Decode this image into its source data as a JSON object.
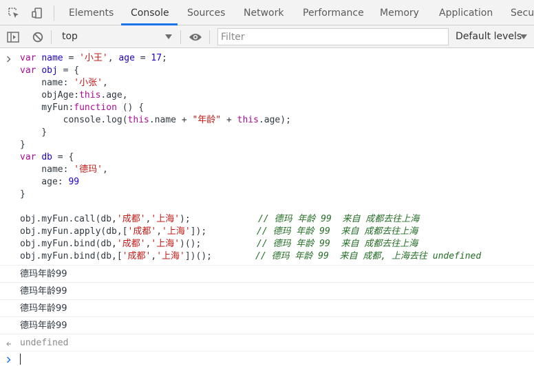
{
  "tabs": [
    {
      "label": "Elements"
    },
    {
      "label": "Console"
    },
    {
      "label": "Sources"
    },
    {
      "label": "Network"
    },
    {
      "label": "Performance"
    },
    {
      "label": "Memory"
    },
    {
      "label": "Application"
    },
    {
      "label": "Secur"
    }
  ],
  "active_tab": "Console",
  "toolbar": {
    "context": "top",
    "filter_placeholder": "Filter",
    "levels": "Default levels"
  },
  "code": [
    [
      [
        "kw",
        "var"
      ],
      [
        "",
        "name",
        "var"
      ],
      [
        "",
        " = "
      ],
      [
        "str",
        "'小王'"
      ],
      [
        "",
        " ,"
      ],
      [
        "var",
        " age"
      ],
      [
        "",
        " = "
      ],
      [
        "num",
        "17"
      ],
      [
        "",
        ";"
      ]
    ],
    [],
    [],
    [],
    [],
    [],
    [],
    [],
    [],
    [],
    [],
    [],
    [],
    [],
    [],
    [],
    []
  ],
  "code_lines": [
    "var name = '小王', age = 17;",
    "var obj = {",
    "    name: '小张',",
    "    objAge:this.age,",
    "    myFun:function () {",
    "        console.log(this.name + \"年龄\" + this.age);",
    "    }",
    "}",
    "var db = {",
    "    name: '德玛',",
    "    age: 99",
    "}",
    "",
    "obj.myFun.call(db,'成都','上海');",
    "obj.myFun.apply(db,['成都','上海']);",
    "obj.myFun.bind(db,'成都','上海')();",
    "obj.myFun.bind(db,['成都','上海'])();"
  ],
  "comments": [
    "// 德玛 年龄 99  来自 成都去往上海",
    "// 德玛 年龄 99  来自 成都去往上海",
    "// 德玛 年龄 99  来自 成都去往上海",
    "// 德玛 年龄 99  来自 成都, 上海去往 undefined"
  ],
  "logs": [
    "德玛年龄99",
    "德玛年龄99",
    "德玛年龄99",
    "德玛年龄99"
  ],
  "result": "undefined"
}
